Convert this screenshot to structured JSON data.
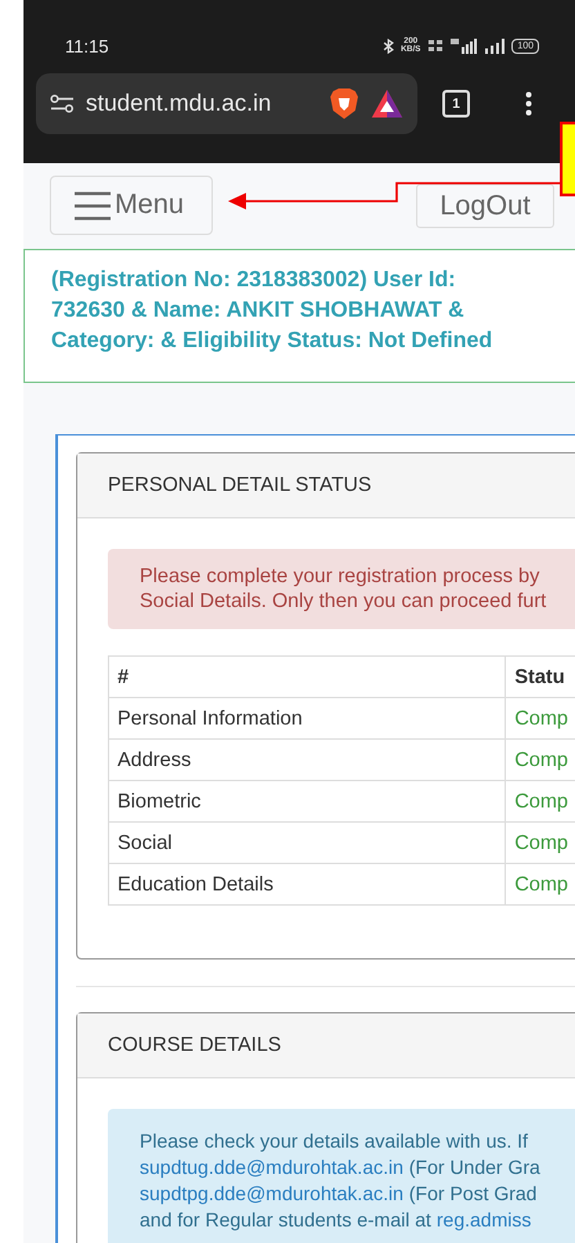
{
  "status_bar": {
    "time": "11:15",
    "speed_value": "200",
    "speed_unit": "KB/S",
    "battery": "100"
  },
  "browser": {
    "url": "student.mdu.ac.in",
    "tab_count": "1"
  },
  "header": {
    "menu": "Menu",
    "logout": "LogOut"
  },
  "user_info": "(Registration No: 2318383002) User Id: 732630 & Name: ANKIT SHOBHAWAT & Category: & Eligibility Status: Not Defined",
  "personal_detail": {
    "title": "PERSONAL DETAIL STATUS",
    "alert_lines": [
      "Please complete your registration process by",
      "Social Details. Only then you can proceed furt"
    ],
    "table": {
      "columns": [
        "#",
        "Statu"
      ],
      "rows": [
        {
          "item": "Personal Information",
          "status": "Comp"
        },
        {
          "item": "Address",
          "status": "Comp"
        },
        {
          "item": "Biometric",
          "status": "Comp"
        },
        {
          "item": "Social",
          "status": "Comp"
        },
        {
          "item": "Education Details",
          "status": "Comp"
        }
      ]
    }
  },
  "course_details": {
    "title": "COURSE DETAILS",
    "notice_lines": [
      [
        {
          "kind": "text",
          "text": "Please check your details available with us. If"
        }
      ],
      [
        {
          "kind": "link",
          "text": "supdtug.dde@mdurohtak.ac.in"
        },
        {
          "kind": "text",
          "text": "(For Under Gra"
        }
      ],
      [
        {
          "kind": "link",
          "text": "supdtpg.dde@mdurohtak.ac.in"
        },
        {
          "kind": "text",
          "text": "(For Post Grad"
        }
      ],
      [
        {
          "kind": "text",
          "text": "and for Regular students e-mail at"
        },
        {
          "kind": "link",
          "text": "reg.admiss"
        }
      ]
    ]
  }
}
